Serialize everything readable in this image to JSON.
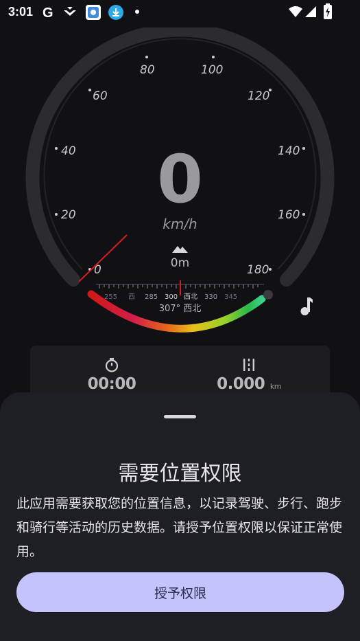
{
  "status_bar": {
    "time": "3:01",
    "icons": [
      "google-g-icon",
      "download-arrow-icon",
      "app-icon",
      "download-icon",
      "dot-icon",
      "wifi-icon",
      "signal-icon",
      "battery-charging-icon"
    ]
  },
  "speedometer": {
    "speed": "0",
    "unit": "km/h",
    "scale_labels": [
      "0",
      "20",
      "40",
      "60",
      "80",
      "100",
      "120",
      "140",
      "160",
      "180"
    ],
    "altitude": "0m",
    "compass_ticks": [
      "255",
      "西",
      "285",
      "300",
      "西北",
      "330",
      "345"
    ],
    "heading": "307° 西北"
  },
  "stats": {
    "time_value": "00:00",
    "distance_value": "0.000",
    "distance_unit": "km"
  },
  "sheet": {
    "title": "需要位置权限",
    "body": "此应用需要获取您的位置信息，以记录驾驶、步行、跑步和骑行等活动的历史数据。请授予位置权限以保证正常使用。",
    "button_label": "授予权限"
  },
  "colors": {
    "background": "#111015",
    "sheet": "#1e1f24",
    "button": "#c4c3fb",
    "needle": "#d31f1f"
  }
}
